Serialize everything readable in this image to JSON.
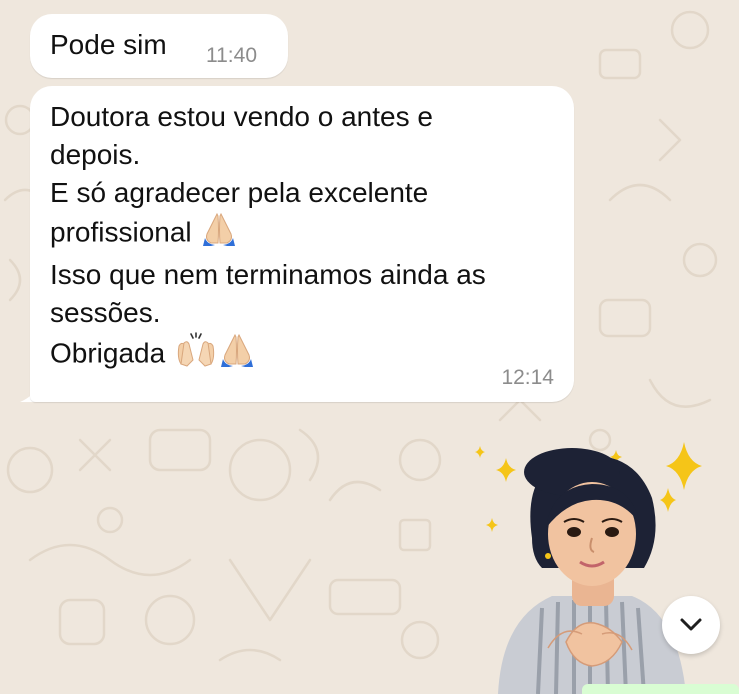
{
  "chat": {
    "messages": [
      {
        "text": "Pode sim",
        "time": "11:40"
      },
      {
        "lines": [
          "Doutora estou vendo o antes e",
          "depois.",
          "E só agradecer pela excelente",
          "profissional",
          "Isso que nem terminamos ainda as",
          "sessões.",
          "Obrigada"
        ],
        "time": "12:14"
      }
    ]
  },
  "icons": {
    "pray": "folded-hands-emoji",
    "raised_hands": "raising-hands-emoji",
    "scroll": "chevron-down-icon"
  },
  "colors": {
    "wallpaper": "#efe7dd",
    "bubble": "#ffffff",
    "timestamp": "#8c8c8c",
    "sparkle": "#f5c518"
  }
}
